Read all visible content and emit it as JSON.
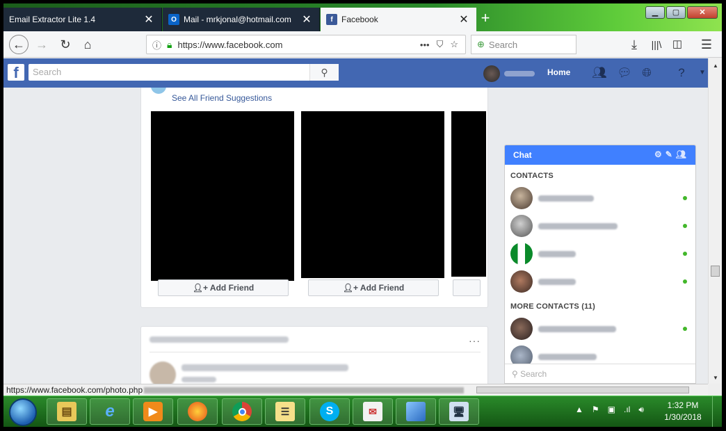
{
  "browser": {
    "tabs": [
      {
        "title": "Email Extractor Lite 1.4",
        "icon": "page-icon"
      },
      {
        "title": "Mail - mrkjonal@hotmail.com",
        "icon": "outlook-icon"
      },
      {
        "title": "Facebook",
        "icon": "facebook-icon"
      }
    ],
    "close_glyph": "✕",
    "new_tab_glyph": "+",
    "url": "https://www.facebook.com",
    "search_placeholder": "Search"
  },
  "facebook": {
    "search_placeholder": "Search",
    "home_label": "Home",
    "see_all_suggestions": "See All Friend Suggestions",
    "add_friend_label": "Add Friend",
    "feed_more": "···"
  },
  "chat": {
    "title": "Chat",
    "contacts_header": "CONTACTS",
    "more_contacts_header": "MORE CONTACTS (11)",
    "search_placeholder": "Search",
    "contact_count_online": 5
  },
  "status": {
    "link_preview": "https://www.facebook.com/photo.php"
  },
  "taskbar": {
    "time": "1:32 PM",
    "date": "1/30/2018"
  },
  "colors": {
    "facebook_blue": "#4267b2",
    "chat_blue": "#4080ff",
    "online_green": "#42b72a"
  }
}
